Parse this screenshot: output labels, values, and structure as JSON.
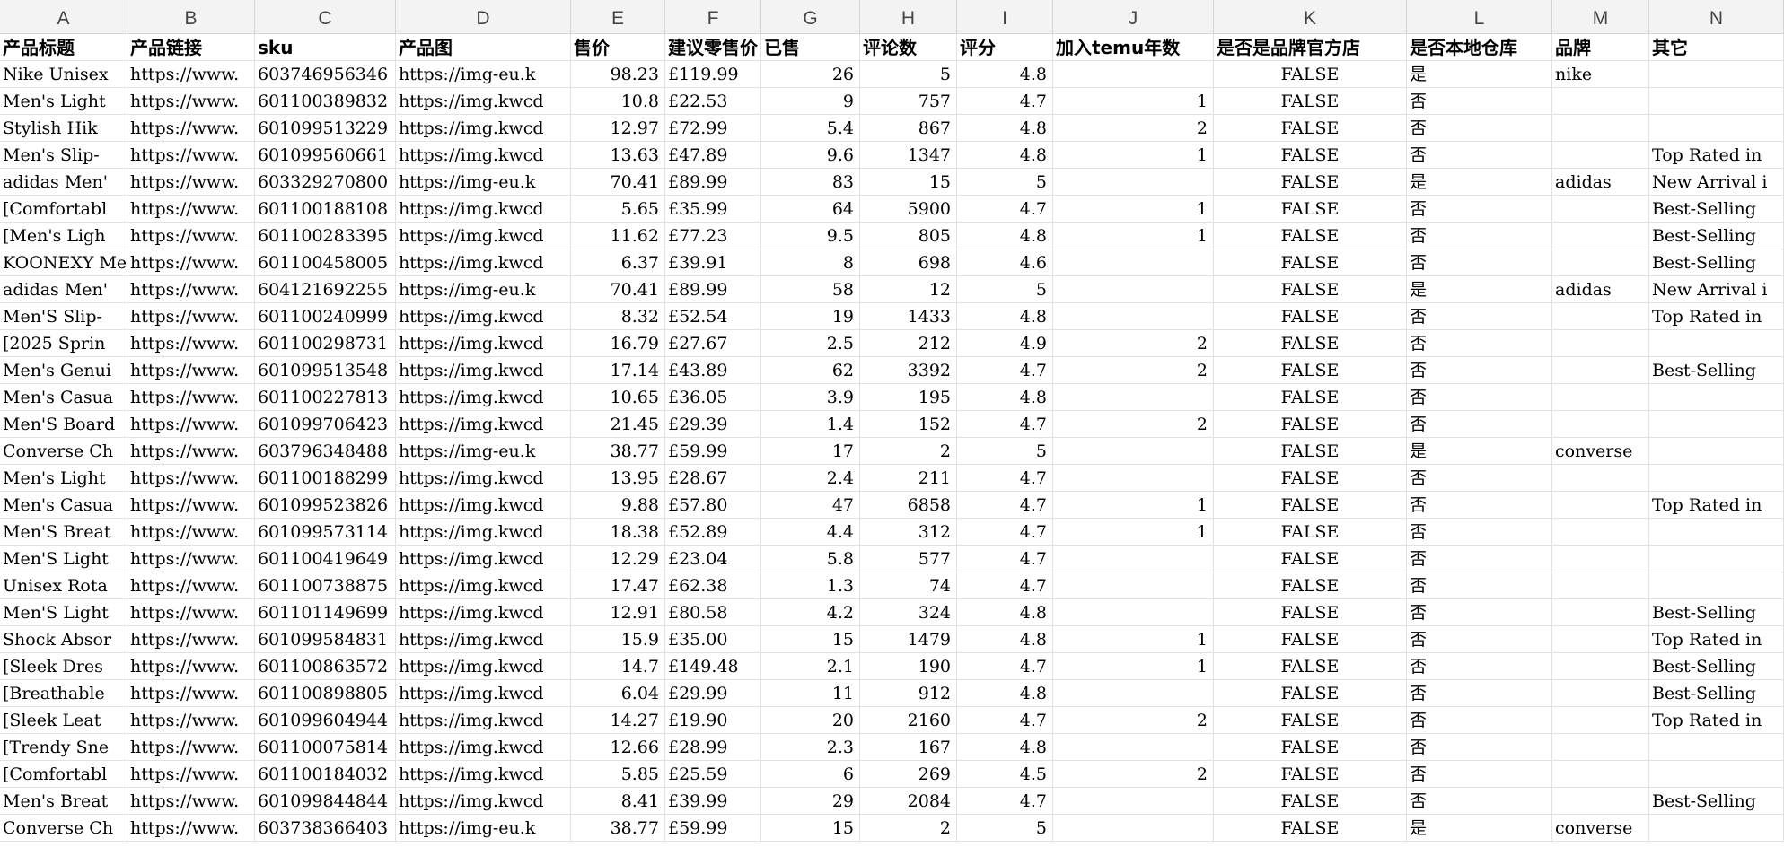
{
  "column_letters": [
    "A",
    "B",
    "C",
    "D",
    "E",
    "F",
    "G",
    "H",
    "I",
    "J",
    "K",
    "L",
    "M",
    "N"
  ],
  "headers": [
    "产品标题",
    "产品链接",
    "sku",
    "产品图",
    "售价",
    "建议零售价",
    "已售",
    "评论数",
    "评分",
    "加入temu年数",
    "是否是品牌官方店",
    "是否本地仓库",
    "品牌",
    "其它"
  ],
  "rows": [
    [
      "Nike Unisex",
      "https://www.",
      "603746956346",
      "https://img-eu.k",
      "98.23",
      "£119.99",
      "26",
      "5",
      "4.8",
      "",
      "FALSE",
      "是",
      "nike",
      ""
    ],
    [
      "Men's Light",
      "https://www.",
      "601100389832",
      "https://img.kwcd",
      "10.8",
      "£22.53",
      "9",
      "757",
      "4.7",
      "1",
      "FALSE",
      "否",
      "",
      ""
    ],
    [
      "Stylish Hik",
      "https://www.",
      "601099513229",
      "https://img.kwcd",
      "12.97",
      "£72.99",
      "5.4",
      "867",
      "4.8",
      "2",
      "FALSE",
      "否",
      "",
      ""
    ],
    [
      "Men's Slip-",
      "https://www.",
      "601099560661",
      "https://img.kwcd",
      "13.63",
      "£47.89",
      "9.6",
      "1347",
      "4.8",
      "1",
      "FALSE",
      "否",
      "",
      "Top Rated in"
    ],
    [
      "adidas Men'",
      "https://www.",
      "603329270800",
      "https://img-eu.k",
      "70.41",
      "£89.99",
      "83",
      "15",
      "5",
      "",
      "FALSE",
      "是",
      "adidas",
      "New Arrival i"
    ],
    [
      "[Comfortabl",
      "https://www.",
      "601100188108",
      "https://img.kwcd",
      "5.65",
      "£35.99",
      "64",
      "5900",
      "4.7",
      "1",
      "FALSE",
      "否",
      "",
      "Best-Selling"
    ],
    [
      "[Men's Ligh",
      "https://www.",
      "601100283395",
      "https://img.kwcd",
      "11.62",
      "£77.23",
      "9.5",
      "805",
      "4.8",
      "1",
      "FALSE",
      "否",
      "",
      "Best-Selling"
    ],
    [
      "KOONEXY Men",
      "https://www.",
      "601100458005",
      "https://img.kwcd",
      "6.37",
      "£39.91",
      "8",
      "698",
      "4.6",
      "",
      "FALSE",
      "否",
      "",
      "Best-Selling"
    ],
    [
      "adidas Men'",
      "https://www.",
      "604121692255",
      "https://img-eu.k",
      "70.41",
      "£89.99",
      "58",
      "12",
      "5",
      "",
      "FALSE",
      "是",
      "adidas",
      "New Arrival i"
    ],
    [
      "Men'S Slip-",
      "https://www.",
      "601100240999",
      "https://img.kwcd",
      "8.32",
      "£52.54",
      "19",
      "1433",
      "4.8",
      "",
      "FALSE",
      "否",
      "",
      "Top Rated in"
    ],
    [
      "[2025 Sprin",
      "https://www.",
      "601100298731",
      "https://img.kwcd",
      "16.79",
      "£27.67",
      "2.5",
      "212",
      "4.9",
      "2",
      "FALSE",
      "否",
      "",
      ""
    ],
    [
      "Men's Genui",
      "https://www.",
      "601099513548",
      "https://img.kwcd",
      "17.14",
      "£43.89",
      "62",
      "3392",
      "4.7",
      "2",
      "FALSE",
      "否",
      "",
      "Best-Selling"
    ],
    [
      "Men's Casua",
      "https://www.",
      "601100227813",
      "https://img.kwcd",
      "10.65",
      "£36.05",
      "3.9",
      "195",
      "4.8",
      "",
      "FALSE",
      "否",
      "",
      ""
    ],
    [
      "Men'S Board",
      "https://www.",
      "601099706423",
      "https://img.kwcd",
      "21.45",
      "£29.39",
      "1.4",
      "152",
      "4.7",
      "2",
      "FALSE",
      "否",
      "",
      ""
    ],
    [
      "Converse Ch",
      "https://www.",
      "603796348488",
      "https://img-eu.k",
      "38.77",
      "£59.99",
      "17",
      "2",
      "5",
      "",
      "FALSE",
      "是",
      "converse",
      ""
    ],
    [
      "Men's Light",
      "https://www.",
      "601100188299",
      "https://img.kwcd",
      "13.95",
      "£28.67",
      "2.4",
      "211",
      "4.7",
      "",
      "FALSE",
      "否",
      "",
      ""
    ],
    [
      "Men's Casua",
      "https://www.",
      "601099523826",
      "https://img.kwcd",
      "9.88",
      "£57.80",
      "47",
      "6858",
      "4.7",
      "1",
      "FALSE",
      "否",
      "",
      "Top Rated in"
    ],
    [
      "Men'S Breat",
      "https://www.",
      "601099573114",
      "https://img.kwcd",
      "18.38",
      "£52.89",
      "4.4",
      "312",
      "4.7",
      "1",
      "FALSE",
      "否",
      "",
      ""
    ],
    [
      "Men'S Light",
      "https://www.",
      "601100419649",
      "https://img.kwcd",
      "12.29",
      "£23.04",
      "5.8",
      "577",
      "4.7",
      "",
      "FALSE",
      "否",
      "",
      ""
    ],
    [
      "Unisex Rota",
      "https://www.",
      "601100738875",
      "https://img.kwcd",
      "17.47",
      "£62.38",
      "1.3",
      "74",
      "4.7",
      "",
      "FALSE",
      "否",
      "",
      ""
    ],
    [
      "Men'S Light",
      "https://www.",
      "601101149699",
      "https://img.kwcd",
      "12.91",
      "£80.58",
      "4.2",
      "324",
      "4.8",
      "",
      "FALSE",
      "否",
      "",
      "Best-Selling"
    ],
    [
      "Shock Absor",
      "https://www.",
      "601099584831",
      "https://img.kwcd",
      "15.9",
      "£35.00",
      "15",
      "1479",
      "4.8",
      "1",
      "FALSE",
      "否",
      "",
      "Top Rated in"
    ],
    [
      "[Sleek Dres",
      "https://www.",
      "601100863572",
      "https://img.kwcd",
      "14.7",
      "£149.48",
      "2.1",
      "190",
      "4.7",
      "1",
      "FALSE",
      "否",
      "",
      "Best-Selling"
    ],
    [
      "[Breathable",
      "https://www.",
      "601100898805",
      "https://img.kwcd",
      "6.04",
      "£29.99",
      "11",
      "912",
      "4.8",
      "",
      "FALSE",
      "否",
      "",
      "Best-Selling"
    ],
    [
      "[Sleek Leat",
      "https://www.",
      "601099604944",
      "https://img.kwcd",
      "14.27",
      "£19.90",
      "20",
      "2160",
      "4.7",
      "2",
      "FALSE",
      "否",
      "",
      "Top Rated in"
    ],
    [
      "[Trendy Sne",
      "https://www.",
      "601100075814",
      "https://img.kwcd",
      "12.66",
      "£28.99",
      "2.3",
      "167",
      "4.8",
      "",
      "FALSE",
      "否",
      "",
      ""
    ],
    [
      "[Comfortabl",
      "https://www.",
      "601100184032",
      "https://img.kwcd",
      "5.85",
      "£25.59",
      "6",
      "269",
      "4.5",
      "2",
      "FALSE",
      "否",
      "",
      ""
    ],
    [
      "Men's Breat",
      "https://www.",
      "601099844844",
      "https://img.kwcd",
      "8.41",
      "£39.99",
      "29",
      "2084",
      "4.7",
      "",
      "FALSE",
      "否",
      "",
      "Best-Selling"
    ],
    [
      "Converse Ch",
      "https://www.",
      "603738366403",
      "https://img-eu.k",
      "38.77",
      "£59.99",
      "15",
      "2",
      "5",
      "",
      "FALSE",
      "是",
      "converse",
      ""
    ]
  ]
}
